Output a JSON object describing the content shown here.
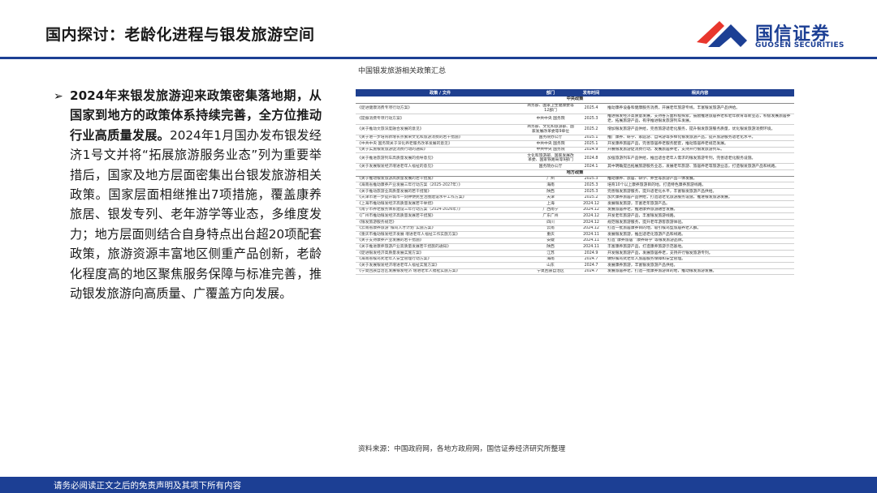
{
  "header": {
    "title": "国内探讨：老龄化进程与银发旅游空间",
    "logo_cn": "国信证券",
    "logo_en": "GUOSEN SECURITIES",
    "brand_color": "#1c3f94",
    "accent_color": "#e8362d"
  },
  "bullet": {
    "mark": "➢",
    "highlight": "2024年来银发旅游迎来政策密集落地期，从国家到地方的政策体系持续完善，全方位推动行业高质量发展。",
    "body": "2024年1月国办发布银发经济1号文并将“拓展旅游服务业态”列为重要举措后，国家及地方层面密集出台银发旅游相关政策。国家层面相继推出7项措施，覆盖康养旅居、银发专列、老年游学等业态，多维度发力；地方层面则结合自身特点出台超20项配套政策，旅游资源丰富地区侧重产品创新，老龄化程度高的地区聚焦服务保障与标准完善，推动银发旅游向高质量、广覆盖方向发展。"
  },
  "table": {
    "caption": "中国银发旅游相关政策汇总",
    "columns": [
      "政策 / 文件",
      "部门",
      "发布时间",
      "相关内容"
    ],
    "group_national": "中央政策",
    "group_local": "地方政策",
    "national_rows": [
      [
        "《促进健康消费专项行动方案》",
        "商务部、国家卫生健康委等12部门",
        "2025.4",
        "推动康养设备和健康服务消费，开展老年旅游专线，丰富银发旅游产品供给。"
      ],
      [
        "《提振消费专项行动方案》",
        "中共中央 国务院",
        "2025.3",
        "推进银发经济高质量发展，支持各方面积极探索，鼓励推进旅居养老和老年教育等新业态，积极发展旅居养老，拓展旅游产品，有序推进银发旅游列车发展。"
      ],
      [
        "《关于推动文旅深度融合发展的意见》",
        "商务部、文化和旅游部、国家发展改革委等9单位",
        "2025.2",
        "增加银发旅游产品供给，完善旅游适老化服务，提升银发旅游服务质量，优化银发旅游消费环境。"
      ],
      [
        "《关于进一步培育新增长点繁荣文化和旅游消费的若干措施》",
        "国务院办公厅",
        "2025.1",
        "推广康养、研学、家庭游、自驾游等多样化银发旅游产品，提升旅游服务适老化水平。"
      ],
      [
        "《中共中央 国务院关于深化养老服务改革发展的意见》",
        "中共中央 国务院",
        "2025.1",
        "开发康养旅居产品，完善旅居养老服务配套，推动旅居养老规范发展。"
      ],
      [
        "《关于实施银发旅游促消费行动的通知》",
        "中共中央 国务院",
        "2024.9",
        "开展银发旅游促消费行动，发展旅居养老，支持开行银发旅游列车。"
      ],
      [
        "《关于推进旅游列车高质量发展的指导意见》",
        "文化和旅游部、国家发展改革委、国家铁路局等9部门",
        "2024.8",
        "加强旅游列车产品供给，推出适合老年人需求的银发旅游专列，完善适老化服务设施。"
      ],
      [
        "《关于发展银发经济增进老年人福祉的意见》",
        "国务院办公厅",
        "2024.1",
        "其中明确提出拓展旅游服务业态，发展老年旅游、旅居养老等旅游业态，打造银发旅游产品和线路。"
      ]
    ],
    "local_rows": [
      [
        "《关于推动银发旅游高质量发展的若干措施》",
        "广州",
        "2025.3",
        "推动康养、旅居、研学、养生等旅游产品一体发展。"
      ],
      [
        "《海南省推动康养产业发展三年行动方案（2025-2027年）》",
        "海南",
        "2025.3",
        "培育10个以上康养旅游目的地，打造特色康养旅游线路。"
      ],
      [
        "《关于推动旅游业高质量发展的若干措施》",
        "陕西",
        "2025.3",
        "完善银发旅游服务，提升适老化水平，丰富银发旅游产品供给。"
      ],
      [
        "《天津市进一步提升城市一刻钟便民生活圈建设水平工作方案》",
        "天津",
        "2025.2",
        "加大康养旅居产品供给，打造适老化旅游服务设施，推进银发旅游发展。"
      ],
      [
        "《上海市推动银发经济高质量发展若干举措》",
        "上海",
        "2024.12",
        "发展银发旅游，丰富老年旅游产品。"
      ],
      [
        "《南宁市养老服务体系建设三年行动方案（2024-2026年）》",
        "广西南宁",
        "2024.12",
        "发展旅居养老，推进康养旅游融合发展。"
      ],
      [
        "《广州市推动银发经济高质量发展若干措施》",
        "广东广州",
        "2024.12",
        "开发老年旅游产品，丰富银发旅游线路。"
      ],
      [
        "《银发旅游服务规范》",
        "四川",
        "2024.12",
        "规范银发旅游服务，提升老年游客旅游体验。"
      ],
      [
        "《云南省康养旅游“候鸟人才计划”实施方案》",
        "云南",
        "2024.12",
        "打造一批旅居康养目的地，吸引候鸟型旅居养老人群。"
      ],
      [
        "《重庆市推动银发经济发展 增进老年人福祉工作实施方案》",
        "重庆",
        "2024.11",
        "发展银发旅游，推出适老化旅游产品和线路。"
      ],
      [
        "《关于支持康养产业发展的若干措施》",
        "安徽",
        "2024.11",
        "打造“康养旅居”“康养研学”等银发旅游品牌。"
      ],
      [
        "《关于推进康养旅游产业高质量发展若干措施的通知》",
        "陕西",
        "2024.11",
        "丰富康养旅游产品，打造康养旅游示范基地。"
      ],
      [
        "《促进银发经济高质量发展实施方案》",
        "江苏",
        "2024.9",
        "开发银发旅游产品，发展旅居养老，支持开行银发旅游专列。"
      ],
      [
        "《海南省候鸟式老年人安全管理行动方案》",
        "海南",
        "2024.7",
        "做好候鸟式老年人旅居服务保障和安全管理。"
      ],
      [
        "《关于发展银发经济增进老年人福祉实施方案》",
        "山东",
        "2024.7",
        "发展康养旅游，丰富银发旅游产品供给。"
      ],
      [
        "《宁夏回族自治区发展银发经济 增进老年人福祉实施方案》",
        "宁夏回族自治区",
        "2024.7",
        "发展旅居养老，打造一批康养旅游目的地，推动银发旅游发展。"
      ]
    ]
  },
  "source": "资料来源：中国政府网，各地方政府网，国信证券经济研究所整理",
  "footer": {
    "disclaimer": "请务必阅读正文之后的免责声明及其项下所有内容"
  }
}
